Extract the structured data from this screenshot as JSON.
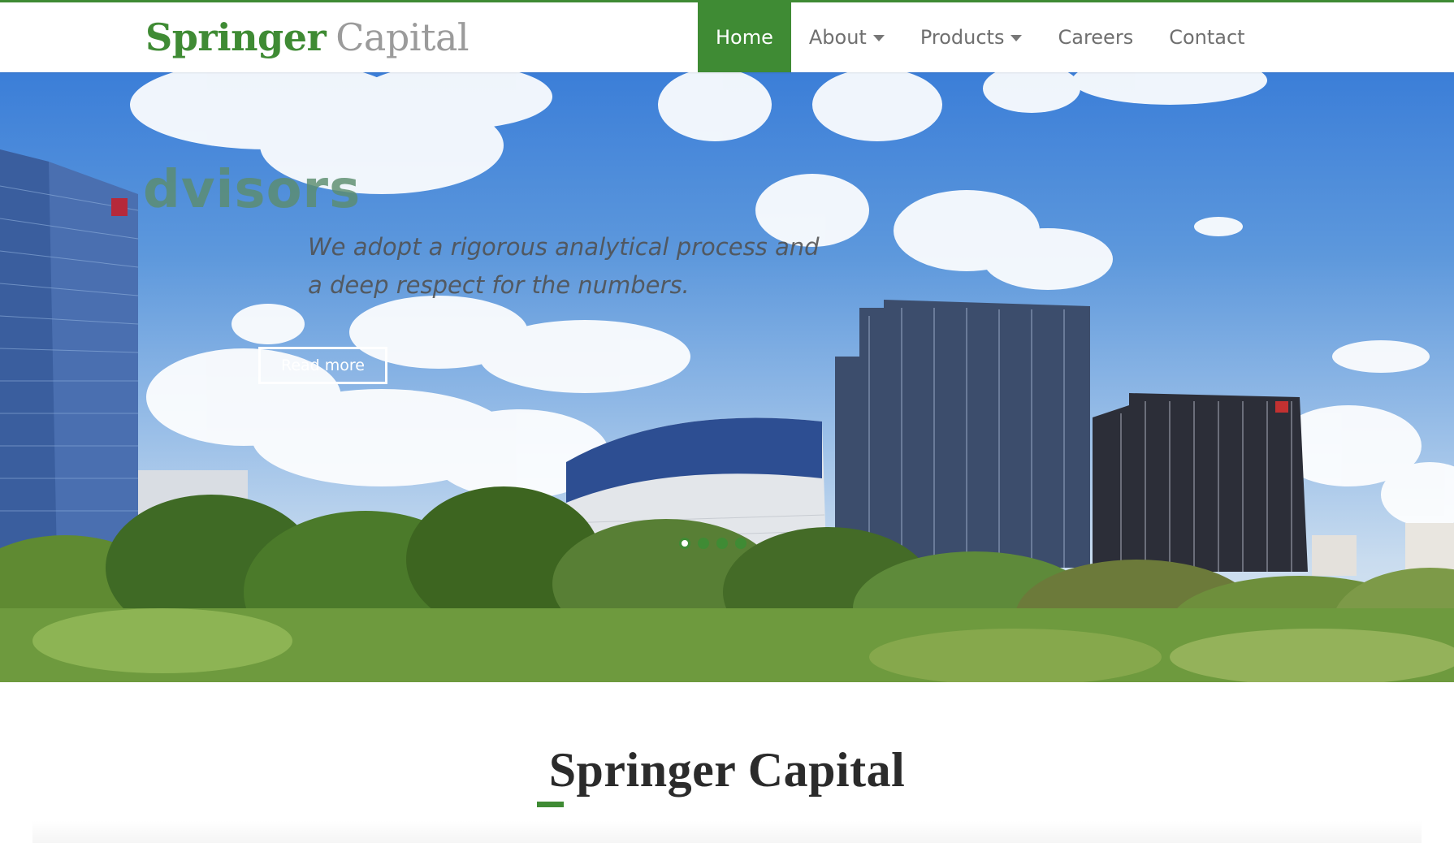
{
  "brand": {
    "name_part1": "Springer",
    "name_part2": "Capital",
    "accent_color": "#3f8b34"
  },
  "nav": {
    "items": [
      {
        "label": "Home",
        "active": true,
        "dropdown": false
      },
      {
        "label": "About",
        "active": false,
        "dropdown": true
      },
      {
        "label": "Products",
        "active": false,
        "dropdown": true
      },
      {
        "label": "Careers",
        "active": false,
        "dropdown": false
      },
      {
        "label": "Contact",
        "active": false,
        "dropdown": false
      }
    ]
  },
  "hero": {
    "heading": "dvisors",
    "caption": "We adopt a rigorous analytical process and a deep respect for the numbers.",
    "button_label": "Read more",
    "slide_count": 4,
    "active_slide": 1
  },
  "section": {
    "title": "Springer Capital"
  }
}
